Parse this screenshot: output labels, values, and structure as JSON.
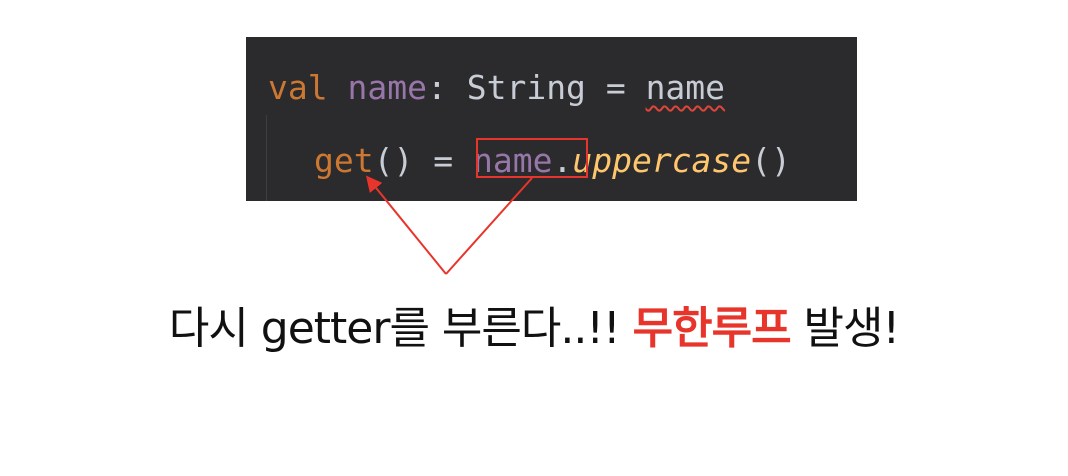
{
  "code": {
    "line1": {
      "keyword": "val",
      "property": "name",
      "colon": ":",
      "type": "String",
      "equals": "=",
      "reference": "name"
    },
    "line2": {
      "getter": "get",
      "parens": "()",
      "equals": "=",
      "target": "name",
      "dot": ".",
      "call": "uppercase",
      "call_parens": "()"
    },
    "colors": {
      "background": "#2b2b2d",
      "keyword": "#cc7832",
      "property": "#9876aa",
      "plain": "#c8ccd4",
      "function": "#ffc66d",
      "error_underline": "#e0453a"
    }
  },
  "annotation": {
    "color": "#e8352b",
    "caption_before": "다시 getter를 부른다..!! ",
    "caption_emphasis": "무한루프",
    "caption_after": " 발생!"
  }
}
